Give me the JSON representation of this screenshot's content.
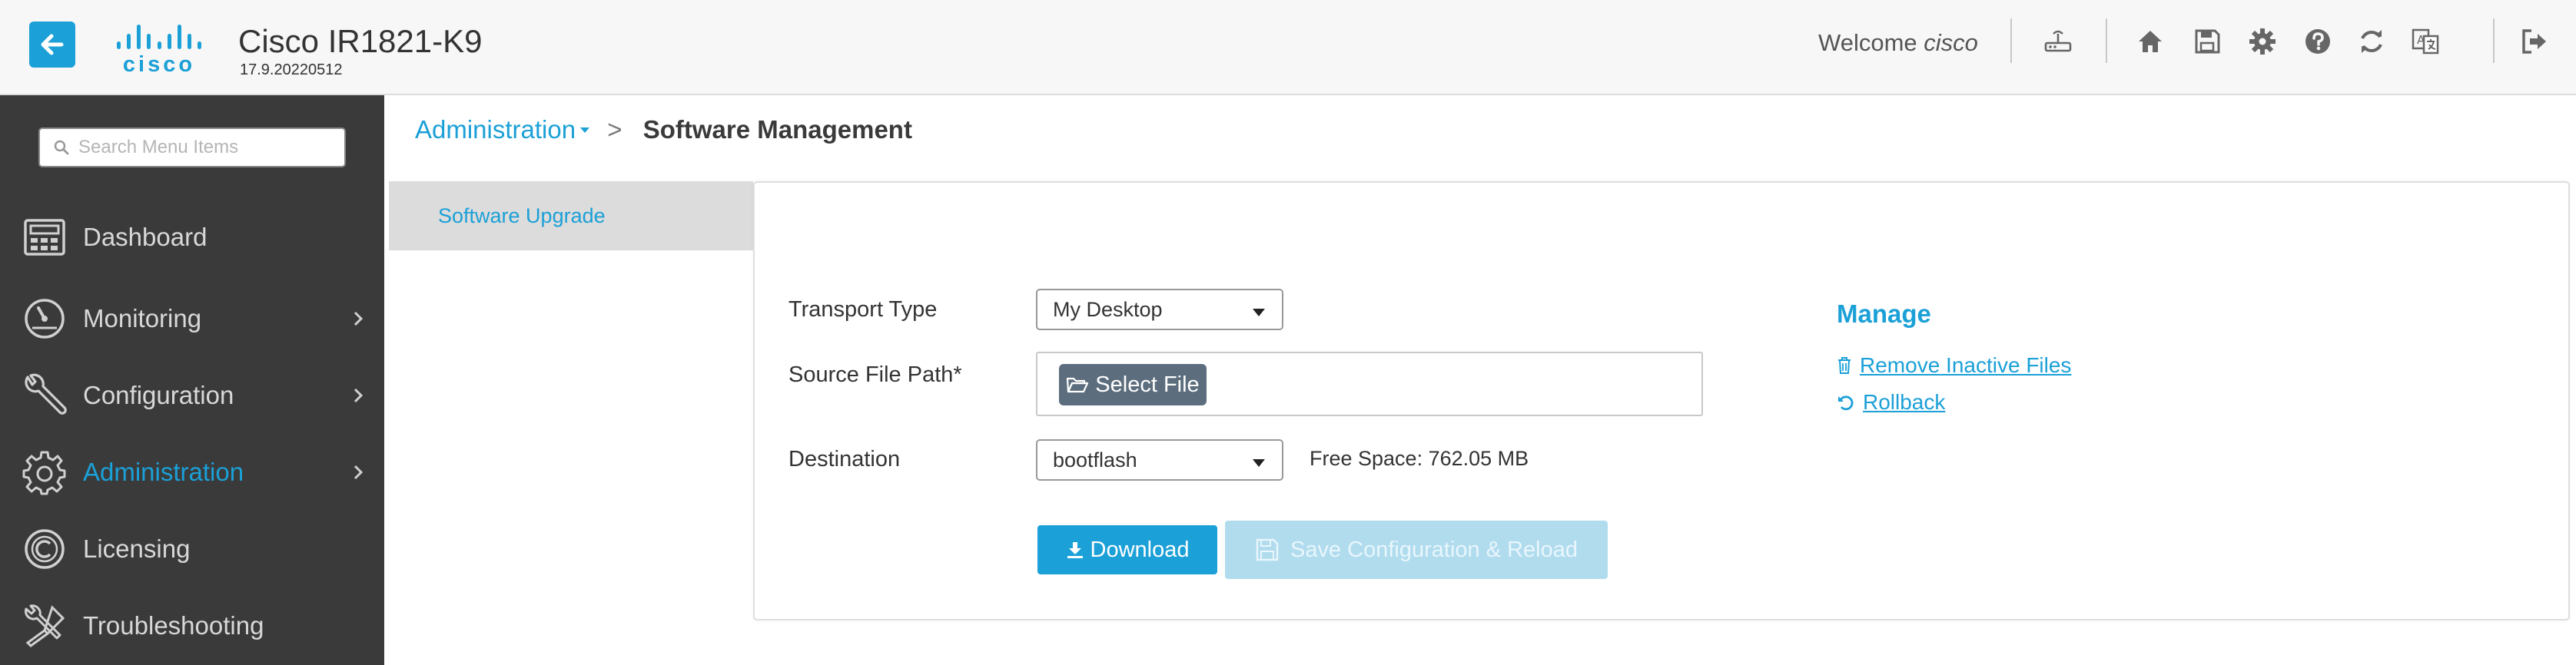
{
  "header": {
    "logo_text": "cisco",
    "device_name": "Cisco IR1821-K9",
    "version": "17.9.20220512",
    "welcome_prefix": "Welcome",
    "username": "cisco",
    "icons": [
      "router-icon",
      "home-icon",
      "save-icon",
      "gear-icon",
      "help-icon",
      "refresh-icon",
      "language-icon",
      "logout-icon"
    ]
  },
  "sidebar": {
    "search_placeholder": "Search Menu Items",
    "items": [
      {
        "label": "Dashboard",
        "icon": "dashboard-icon",
        "has_children": false,
        "active": false
      },
      {
        "label": "Monitoring",
        "icon": "monitoring-icon",
        "has_children": true,
        "active": false
      },
      {
        "label": "Configuration",
        "icon": "wrench-icon",
        "has_children": true,
        "active": false
      },
      {
        "label": "Administration",
        "icon": "gear-icon",
        "has_children": true,
        "active": true
      },
      {
        "label": "Licensing",
        "icon": "licensing-icon",
        "has_children": false,
        "active": false
      },
      {
        "label": "Troubleshooting",
        "icon": "tools-icon",
        "has_children": false,
        "active": false
      }
    ]
  },
  "breadcrumb": {
    "parent": "Administration",
    "separator": ">",
    "current": "Software Management"
  },
  "subnav": {
    "active_label": "Software Upgrade"
  },
  "form": {
    "transport_label": "Transport Type",
    "transport_value": "My Desktop",
    "source_label": "Source File Path*",
    "select_file_label": "Select File",
    "destination_label": "Destination",
    "destination_value": "bootflash",
    "free_space": "Free Space: 762.05 MB",
    "download_label": "Download",
    "save_reload_label": "Save Configuration & Reload"
  },
  "manage": {
    "title": "Manage",
    "remove_label": "Remove Inactive Files",
    "rollback_label": "Rollback"
  },
  "colors": {
    "accent": "#1ba0d7",
    "sidebar_bg": "#3a3a3a",
    "file_button": "#5c6d7d",
    "disabled_button": "#b0dcee"
  }
}
